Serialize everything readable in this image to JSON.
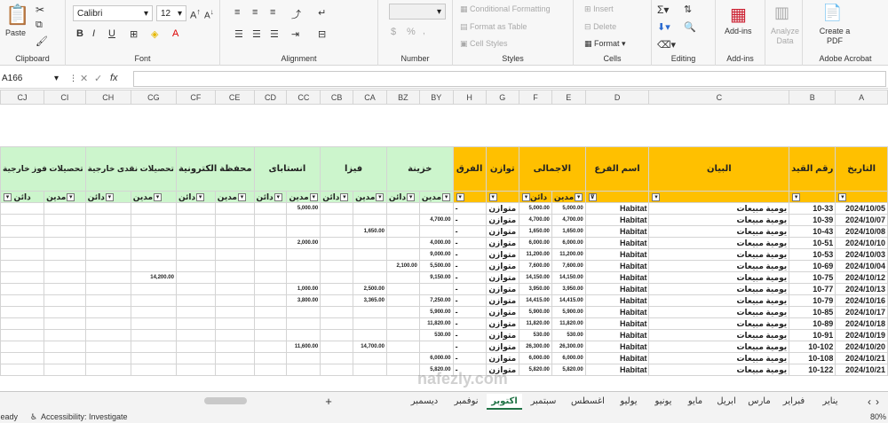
{
  "ribbon": {
    "clipboard": {
      "paste": "Paste",
      "label": "Clipboard"
    },
    "font": {
      "name": "Calibri",
      "size": "12",
      "label": "Font"
    },
    "alignment": {
      "label": "Alignment"
    },
    "number": {
      "label": "Number"
    },
    "styles": {
      "conditional": "Conditional Formatting",
      "format_table": "Format as Table",
      "cell_styles": "Cell Styles",
      "label": "Styles"
    },
    "cells": {
      "insert": "Insert",
      "delete": "Delete",
      "format": "Format",
      "label": "Cells"
    },
    "editing": {
      "label": "Editing"
    },
    "addins": {
      "button": "Add-ins",
      "label": "Add-ins"
    },
    "analyze": {
      "button": "Analyze Data"
    },
    "acrobat": {
      "button": "Create a PDF",
      "label": "Adobe Acrobat"
    }
  },
  "formula_bar": {
    "name_box": "A166",
    "fx": "fx",
    "content": ""
  },
  "columns": [
    "CJ",
    "CI",
    "CH",
    "CG",
    "CF",
    "CE",
    "CD",
    "CC",
    "CB",
    "CA",
    "BZ",
    "BY",
    "H",
    "G",
    "F",
    "E",
    "D",
    "C",
    "B",
    "A"
  ],
  "headers": {
    "payments_foreign": "تحصيلات فوز خارجية",
    "payments_cash": "تحصيلات نقدى خارجية",
    "wallet": "محفظة الكترونية",
    "instapay": "انستاباى",
    "visa": "فيزا",
    "treasury": "خزينة",
    "diff": "الفرق",
    "balance": "توازن",
    "total": "الاجمالى",
    "branch": "اسم الفرع",
    "statement": "البيان",
    "entry_no": "رقم القيد",
    "date": "التاريخ"
  },
  "subheaders": {
    "debit": "مدين",
    "credit": "دائن"
  },
  "rows": [
    {
      "date": "2024/10/05",
      "no": "10-33",
      "desc": "يومية مبيعات",
      "branch": "Habitat",
      "e": "5,000.00",
      "f": "5,000.00",
      "g": "متوازن",
      "h": "-",
      "by": "",
      "bz": "",
      "cc": "5,000.00",
      "ca": "",
      "cg": ""
    },
    {
      "date": "2024/10/07",
      "no": "10-39",
      "desc": "يومية مبيعات",
      "branch": "Habitat",
      "e": "4,700.00",
      "f": "4,700.00",
      "g": "متوازن",
      "h": "-",
      "by": "4,700.00",
      "bz": "",
      "cc": "",
      "ca": "",
      "cg": ""
    },
    {
      "date": "2024/10/08",
      "no": "10-43",
      "desc": "يومية مبيعات",
      "branch": "Habitat",
      "e": "1,650.00",
      "f": "1,650.00",
      "g": "متوازن",
      "h": "-",
      "by": "",
      "bz": "",
      "cc": "",
      "ca": "1,650.00",
      "cg": ""
    },
    {
      "date": "2024/10/10",
      "no": "10-51",
      "desc": "يومية مبيعات",
      "branch": "Habitat",
      "e": "6,000.00",
      "f": "6,000.00",
      "g": "متوازن",
      "h": "-",
      "by": "4,000.00",
      "bz": "",
      "cc": "2,000.00",
      "ca": "",
      "cg": ""
    },
    {
      "date": "2024/10/03",
      "no": "10-53",
      "desc": "يومية مبيعات",
      "branch": "Habitat",
      "e": "11,200.00",
      "f": "11,200.00",
      "g": "متوازن",
      "h": "-",
      "by": "9,000.00",
      "bz": "",
      "cc": "",
      "ca": "",
      "cg": ""
    },
    {
      "date": "2024/10/04",
      "no": "10-69",
      "desc": "يومية مبيعات",
      "branch": "Habitat",
      "e": "7,600.00",
      "f": "7,600.00",
      "g": "متوازن",
      "h": "-",
      "by": "5,500.00",
      "bz": "2,100.00",
      "cc": "",
      "ca": "",
      "cg": ""
    },
    {
      "date": "2024/10/12",
      "no": "10-75",
      "desc": "يومية مبيعات",
      "branch": "Habitat",
      "e": "14,150.00",
      "f": "14,150.00",
      "g": "متوازن",
      "h": "-",
      "by": "9,150.00",
      "bz": "",
      "cc": "",
      "ca": "",
      "cg": "14,200.00"
    },
    {
      "date": "2024/10/13",
      "no": "10-77",
      "desc": "يومية مبيعات",
      "branch": "Habitat",
      "e": "3,950.00",
      "f": "3,950.00",
      "g": "متوازن",
      "h": "-",
      "by": "",
      "bz": "",
      "cc": "1,000.00",
      "ca": "2,500.00",
      "cg": ""
    },
    {
      "date": "2024/10/16",
      "no": "10-79",
      "desc": "يومية مبيعات",
      "branch": "Habitat",
      "e": "14,415.00",
      "f": "14,415.00",
      "g": "متوازن",
      "h": "-",
      "by": "7,250.00",
      "bz": "",
      "cc": "3,800.00",
      "ca": "3,365.00",
      "cg": ""
    },
    {
      "date": "2024/10/17",
      "no": "10-85",
      "desc": "يومية مبيعات",
      "branch": "Habitat",
      "e": "5,900.00",
      "f": "5,900.00",
      "g": "متوازن",
      "h": "-",
      "by": "5,900.00",
      "bz": "",
      "cc": "",
      "ca": "",
      "cg": ""
    },
    {
      "date": "2024/10/18",
      "no": "10-89",
      "desc": "يومية مبيعات",
      "branch": "Habitat",
      "e": "11,820.00",
      "f": "11,820.00",
      "g": "متوازن",
      "h": "-",
      "by": "11,820.00",
      "bz": "",
      "cc": "",
      "ca": "",
      "cg": ""
    },
    {
      "date": "2024/10/19",
      "no": "10-91",
      "desc": "يومية مبيعات",
      "branch": "Habitat",
      "e": "530.00",
      "f": "530.00",
      "g": "متوازن",
      "h": "-",
      "by": "530.00",
      "bz": "",
      "cc": "",
      "ca": "",
      "cg": ""
    },
    {
      "date": "2024/10/20",
      "no": "10-102",
      "desc": "يومية مبيعات",
      "branch": "Habitat",
      "e": "26,300.00",
      "f": "26,300.00",
      "g": "متوازن",
      "h": "-",
      "by": "",
      "bz": "",
      "cc": "11,600.00",
      "ca": "14,700.00",
      "cg": ""
    },
    {
      "date": "2024/10/21",
      "no": "10-108",
      "desc": "يومية مبيعات",
      "branch": "Habitat",
      "e": "6,000.00",
      "f": "6,000.00",
      "g": "متوازن",
      "h": "-",
      "by": "6,000.00",
      "bz": "",
      "cc": "",
      "ca": "",
      "cg": ""
    },
    {
      "date": "2024/10/21",
      "no": "10-122",
      "desc": "يومية مبيعات",
      "branch": "Habitat",
      "e": "5,820.00",
      "f": "5,820.00",
      "g": "متوازن",
      "h": "-",
      "by": "5,820.00",
      "bz": "",
      "cc": "",
      "ca": "",
      "cg": ""
    }
  ],
  "sheet_tabs": [
    "يناير",
    "فبراير",
    "مارس",
    "ابريل",
    "مايو",
    "يونيو",
    "يوليو",
    "اغسطس",
    "سبتمبر",
    "اكتوبر",
    "نوفمبر",
    "ديسمبر"
  ],
  "active_tab": "اكتوبر",
  "status": {
    "ready": "Ready",
    "accessibility": "Accessibility: Investigate",
    "zoom": "80%"
  },
  "watermark": "nafezly.com"
}
